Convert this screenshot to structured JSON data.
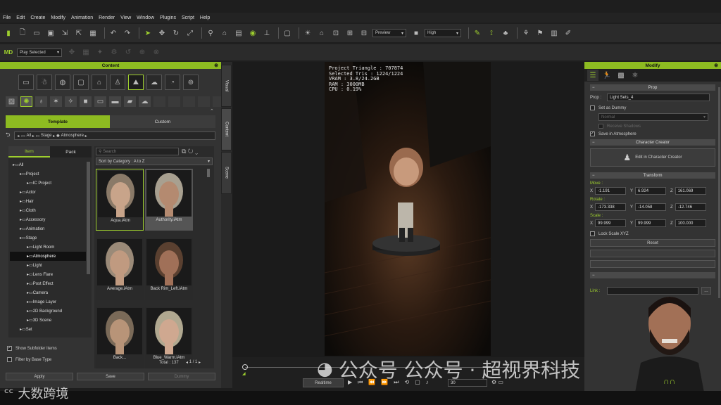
{
  "menu": [
    "File",
    "Edit",
    "Create",
    "Modify",
    "Animation",
    "Render",
    "View",
    "Window",
    "Plugins",
    "Script",
    "Help"
  ],
  "toolbar": {
    "preview_label": "Preview",
    "quality_label": "High",
    "play_selected_label": "Play Selected"
  },
  "content": {
    "title": "Content",
    "tabs": {
      "template": "Template",
      "custom": "Custom"
    },
    "breadcrumb": [
      "All",
      "Stage",
      "Atmosphere"
    ],
    "subtabs": {
      "item": "Item",
      "pack": "Pack"
    },
    "search_placeholder": "Search",
    "sort_label": "Sort by Category : A to Z",
    "tree": [
      {
        "label": "All",
        "indent": 0
      },
      {
        "label": "Project",
        "indent": 1
      },
      {
        "label": "IC Project",
        "indent": 2
      },
      {
        "label": "Actor",
        "indent": 1
      },
      {
        "label": "Hair",
        "indent": 1
      },
      {
        "label": "Cloth",
        "indent": 1
      },
      {
        "label": "Accessory",
        "indent": 1
      },
      {
        "label": "Animation",
        "indent": 1
      },
      {
        "label": "Stage",
        "indent": 1
      },
      {
        "label": "Light Room",
        "indent": 2
      },
      {
        "label": "Atmosphere",
        "indent": 2,
        "selected": true
      },
      {
        "label": "Light",
        "indent": 2
      },
      {
        "label": "Lens Flare",
        "indent": 2
      },
      {
        "label": "Post Effect",
        "indent": 2
      },
      {
        "label": "Camera",
        "indent": 2
      },
      {
        "label": "Image Layer",
        "indent": 2
      },
      {
        "label": "2D Background",
        "indent": 2
      },
      {
        "label": "3D Scene",
        "indent": 2
      },
      {
        "label": "Set",
        "indent": 1
      }
    ],
    "items": [
      {
        "label": "Aqua.iAtm"
      },
      {
        "label": "Authority.iAtm"
      },
      {
        "label": "Average.iAtm"
      },
      {
        "label": "Back Rim_Left.iAtm"
      },
      {
        "label": "Back..."
      },
      {
        "label": "Blue_Warm.iAtm"
      }
    ],
    "show_subfolder_label": "Show Subfolder Items",
    "filter_label": "Filter by Base Type",
    "total_label": "Total : 137",
    "page_label": "1 / 1",
    "apply_label": "Apply",
    "save_label": "Save",
    "dummy_label": "Dummy"
  },
  "side_tabs": {
    "visual": "Visual",
    "content": "Content",
    "scene": "Scene"
  },
  "viewport": {
    "stats": [
      "Project Triangle : 707874",
      "Selected Tris : 1224/1224",
      "VRAM : 3.8/24.2GB",
      "RAM : 3000MB",
      "CPU : 0.19%"
    ]
  },
  "modify": {
    "title": "Modify",
    "prop_section": "Prop",
    "prop_label": "Prop :",
    "prop_value": "Light Sets_4",
    "set_as_dummy": "Set as Dummy",
    "normal_label": "Normal",
    "receive_shadows": "Receive Shadows",
    "save_in_atmosphere": "Save in Atmosphere",
    "cc_section": "Character Creator",
    "edit_cc": "Edit in Character Creator",
    "transform_section": "Transform",
    "move_label": "Move :",
    "move": {
      "x": "-1.191",
      "y": "6.924",
      "z": "161.069"
    },
    "rotate_label": "Rotate :",
    "rotate": {
      "x": "-173.338",
      "y": "-14.058",
      "z": "-12.746"
    },
    "scale_label": "Scale :",
    "scale": {
      "x": "99.999",
      "y": "99.999",
      "z": "100.000"
    },
    "lock_scale": "Lock Scale XYZ",
    "reset_label": "Reset",
    "link_label": "Link :"
  },
  "timeline": {
    "realtime_label": "Realtime",
    "fps_value": "30"
  },
  "watermark": {
    "right": "公众号 公众号 · 超视界科技",
    "left": "大数跨境"
  },
  "colors": {
    "accent": "#9ecf2e",
    "panel": "#333333"
  }
}
